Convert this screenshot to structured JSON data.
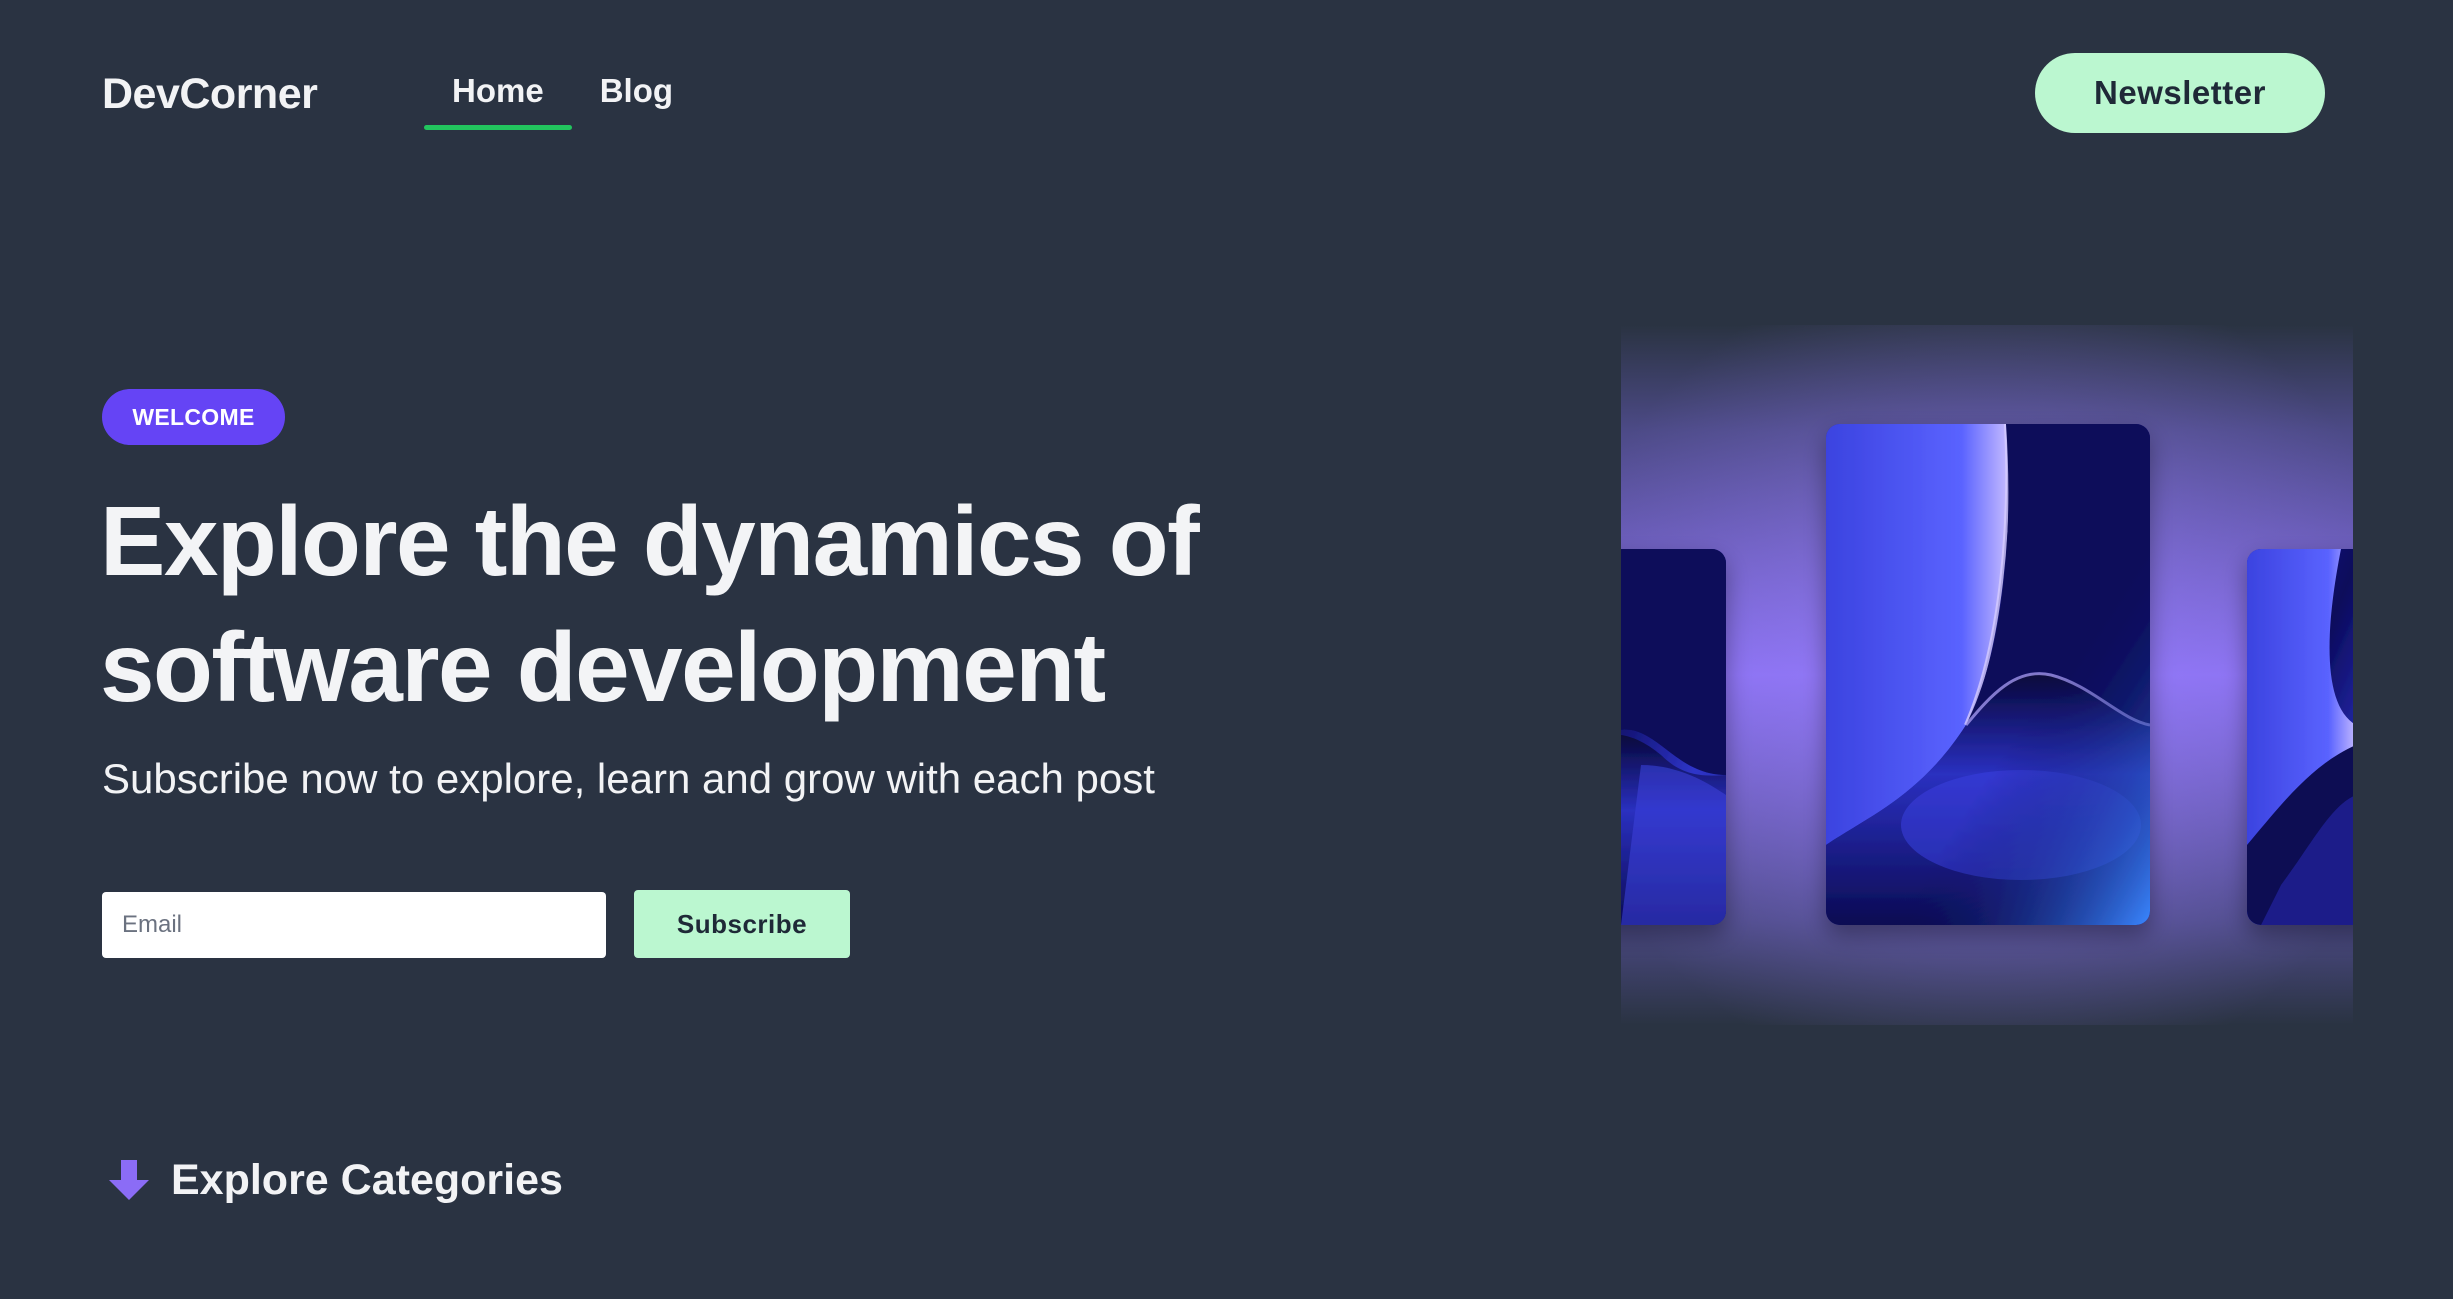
{
  "header": {
    "brand": "DevCorner",
    "nav": [
      {
        "label": "Home",
        "active": true
      },
      {
        "label": "Blog",
        "active": false
      }
    ],
    "newsletter_label": "Newsletter"
  },
  "hero": {
    "badge": "WELCOME",
    "headline_line1": "Explore the dynamics of",
    "headline_line2": "software development",
    "subtitle": "Subscribe now to explore, learn and grow with each post",
    "email_placeholder": "Email",
    "email_value": "",
    "subscribe_label": "Subscribe"
  },
  "section": {
    "title": "Explore Categories",
    "icon": "arrow-down-icon"
  },
  "colors": {
    "background": "#2a3342",
    "accent_green": "#bbf7d0",
    "underline_green": "#22c55e",
    "badge_purple": "#6544f5",
    "icon_purple": "#8b6cf6"
  }
}
